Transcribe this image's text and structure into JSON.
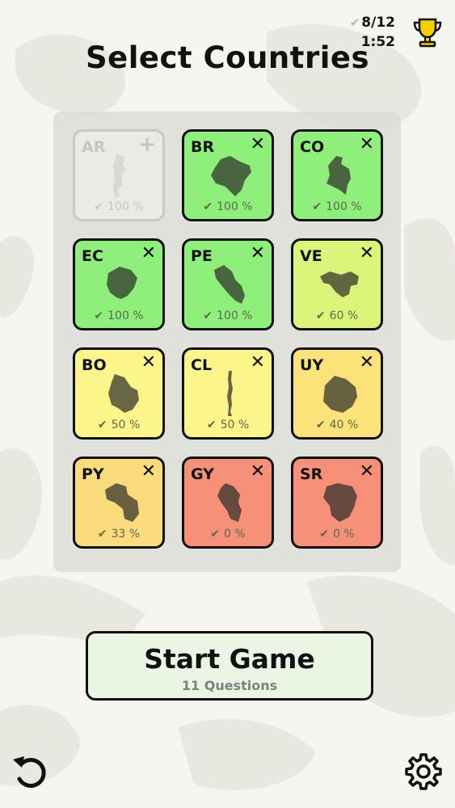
{
  "header": {
    "title": "Select Countries",
    "score": "8/12",
    "timer": "1:52",
    "check_icon": "check-icon",
    "trophy_icon": "trophy-icon",
    "trophy_color": "#f2d000"
  },
  "grid": {
    "cards": [
      {
        "code": "AR",
        "percent": "100 %",
        "selected": false,
        "toggle": "+",
        "color": "#ebebe6",
        "icon": "argentina-map-icon"
      },
      {
        "code": "BR",
        "percent": "100 %",
        "selected": true,
        "toggle": "✕",
        "color": "#8ef07a",
        "icon": "brazil-map-icon"
      },
      {
        "code": "CO",
        "percent": "100 %",
        "selected": true,
        "toggle": "✕",
        "color": "#8ef07a",
        "icon": "colombia-map-icon"
      },
      {
        "code": "EC",
        "percent": "100 %",
        "selected": true,
        "toggle": "✕",
        "color": "#8ef07a",
        "icon": "ecuador-map-icon"
      },
      {
        "code": "PE",
        "percent": "100 %",
        "selected": true,
        "toggle": "✕",
        "color": "#8ef07a",
        "icon": "peru-map-icon"
      },
      {
        "code": "VE",
        "percent": "60 %",
        "selected": true,
        "toggle": "✕",
        "color": "#dcf47a",
        "icon": "venezuela-map-icon"
      },
      {
        "code": "BO",
        "percent": "50 %",
        "selected": true,
        "toggle": "✕",
        "color": "#fbf58a",
        "icon": "bolivia-map-icon"
      },
      {
        "code": "CL",
        "percent": "50 %",
        "selected": true,
        "toggle": "✕",
        "color": "#fbf58a",
        "icon": "chile-map-icon"
      },
      {
        "code": "UY",
        "percent": "40 %",
        "selected": true,
        "toggle": "✕",
        "color": "#fbe37a",
        "icon": "uruguay-map-icon"
      },
      {
        "code": "PY",
        "percent": "33 %",
        "selected": true,
        "toggle": "✕",
        "color": "#fbdc7c",
        "icon": "paraguay-map-icon"
      },
      {
        "code": "GY",
        "percent": "0 %",
        "selected": true,
        "toggle": "✕",
        "color": "#f69078",
        "icon": "guyana-map-icon"
      },
      {
        "code": "SR",
        "percent": "0 %",
        "selected": true,
        "toggle": "✕",
        "color": "#f69078",
        "icon": "suriname-map-icon"
      }
    ]
  },
  "start_button": {
    "label": "Start Game",
    "subtitle": "11 Questions",
    "color": "#eaf6e3"
  },
  "footer": {
    "undo_icon": "undo-icon",
    "settings_icon": "gear-icon"
  }
}
